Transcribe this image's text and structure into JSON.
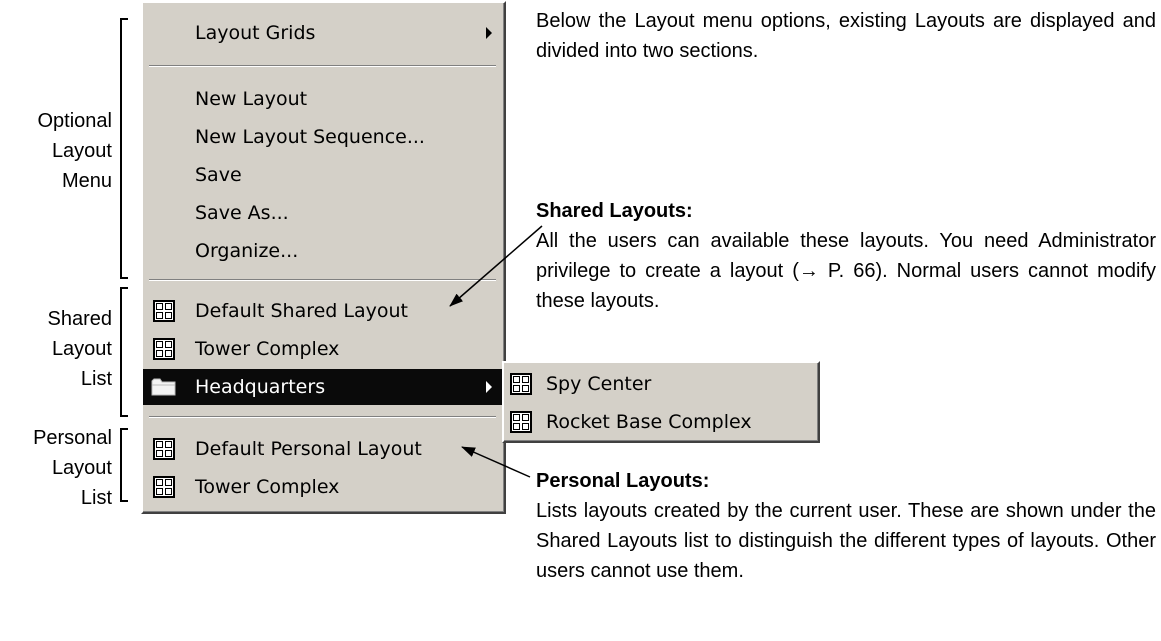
{
  "side_labels": {
    "optional": [
      "Optional",
      "Layout",
      "Menu"
    ],
    "shared": [
      "Shared",
      "Layout",
      "List"
    ],
    "personal": [
      "Personal",
      "Layout",
      "List"
    ]
  },
  "menu": {
    "layout_grids": "Layout Grids",
    "options": [
      "New Layout",
      "New Layout Sequence...",
      "Save",
      "Save As...",
      "Organize..."
    ],
    "shared_layouts": [
      "Default Shared Layout",
      "Tower Complex"
    ],
    "folder": "Headquarters",
    "personal_layouts": [
      "Default Personal Layout",
      "Tower Complex"
    ]
  },
  "submenu": {
    "items": [
      "Spy Center",
      "Rocket Base Complex"
    ]
  },
  "intro_text": "Below the Layout menu options, existing Layouts are displayed and divided into two sections.",
  "shared_section": {
    "heading": "Shared Layouts:",
    "body": "All the users can available these layouts. You need Administrator privilege to create a layout (→ P. 66). Normal users cannot modify these layouts."
  },
  "personal_section": {
    "heading": "Personal Layouts:",
    "body": "Lists layouts created by the current user. These are shown under the Shared Layouts list to distinguish the different types of layouts. Other users cannot use them."
  },
  "icons": [
    "layout-grid-icon",
    "folder-icon",
    "submenu-arrow-icon"
  ]
}
